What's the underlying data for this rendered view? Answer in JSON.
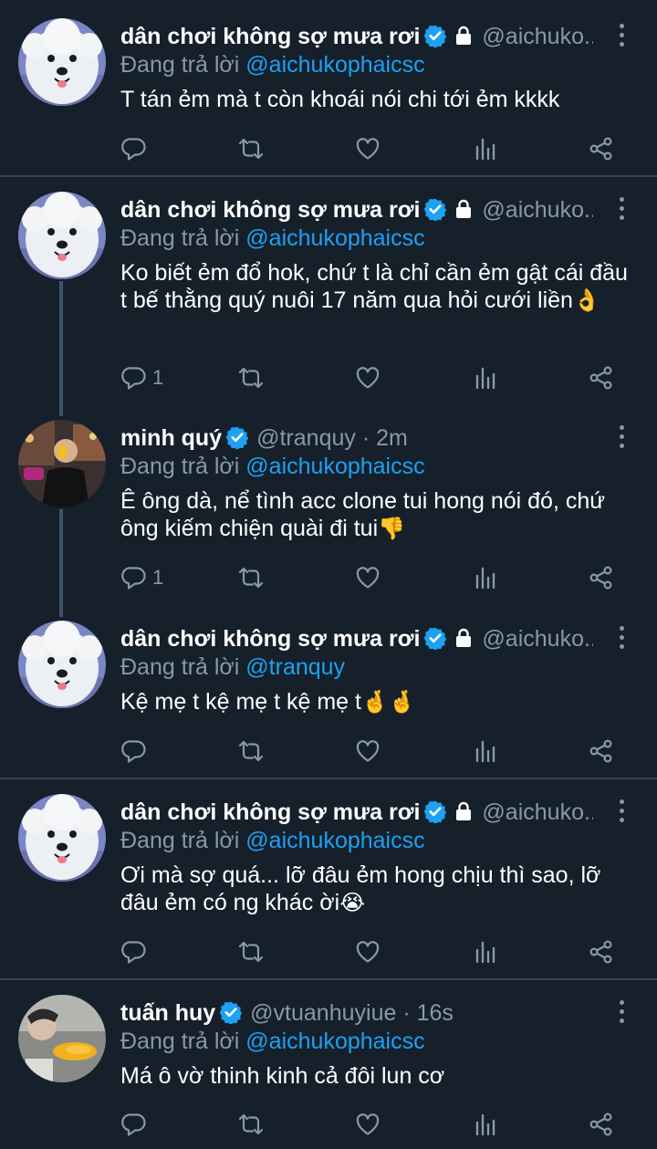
{
  "colors": {
    "background": "#15202b",
    "text": "#ffffff",
    "secondary": "#8899a6",
    "accent": "#1da1f2",
    "divider": "#38444d",
    "thread_line": "#3d5466"
  },
  "icons": [
    "verified-badge-icon",
    "lock-icon",
    "more-icon",
    "reply-icon",
    "retweet-icon",
    "like-icon",
    "analytics-icon",
    "share-icon"
  ],
  "replying_prefix": "Đang trả lời",
  "tweets": [
    {
      "name": "dân chơi không sợ mưa rơi",
      "handle": "@aichuko...",
      "replying_to": "@aichukophaicsc",
      "text": "T tán ẻm mà t còn khoái nói chi tới ẻm kkkk",
      "emoji": "",
      "reply_count": ""
    },
    {
      "name": "dân chơi không sợ mưa rơi",
      "handle": "@aichuko...",
      "replying_to": "@aichukophaicsc",
      "text": "Ko biết ẻm đổ hok, chứ t là chỉ cần ẻm gật cái đầu t bế thằng quý nuôi 17 năm qua hỏi cưới liền",
      "emoji": "👌",
      "reply_count": "1"
    },
    {
      "name": "minh quý",
      "handle": "@tranquy · 2m",
      "replying_to": "@aichukophaicsc",
      "text": "Ê ông dà, nể tình acc clone tui hong nói đó, chứ ông kiếm chiện quài đi tui",
      "emoji": "👎",
      "reply_count": "1"
    },
    {
      "name": "dân chơi không sợ mưa rơi",
      "handle": "@aichuko...",
      "replying_to": "@tranquy",
      "text": "Kệ mẹ t kệ mẹ t kệ mẹ t",
      "emoji": "🤞🤞",
      "reply_count": ""
    },
    {
      "name": "dân chơi không sợ mưa rơi",
      "handle": "@aichuko...",
      "replying_to": "@aichukophaicsc",
      "text": "Ơi mà sợ quá... lỡ đâu ẻm hong chịu thì sao, lỡ đâu ẻm có ng khác ời",
      "emoji": "😭",
      "reply_count": ""
    },
    {
      "name": "tuấn huy",
      "handle": "@vtuanhuyiue · 16s",
      "replying_to": "@aichukophaicsc",
      "text": "Má ô vờ thinh kinh cả đôi lun cơ",
      "emoji": "",
      "reply_count": ""
    }
  ]
}
